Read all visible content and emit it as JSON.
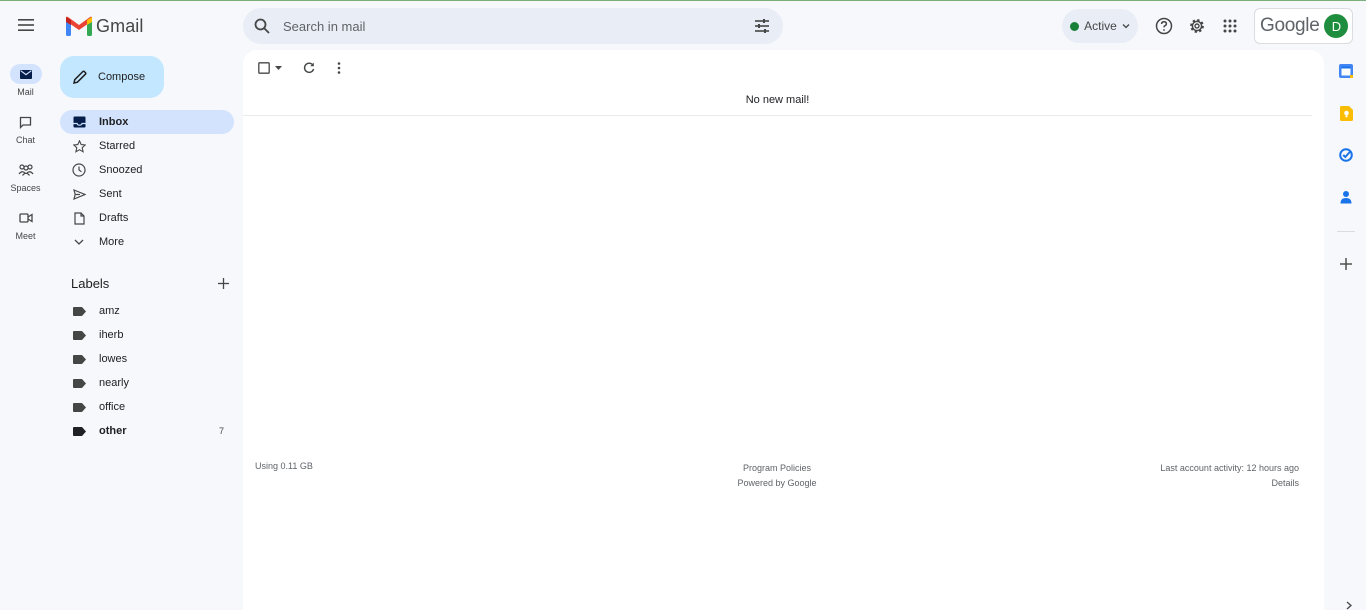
{
  "header": {
    "app_name": "Gmail",
    "search_placeholder": "Search in mail",
    "status_label": "Active",
    "account_brand": "Google",
    "avatar_initial": "D"
  },
  "rail": {
    "items": [
      {
        "label": "Mail",
        "icon": "mail-icon",
        "active": true
      },
      {
        "label": "Chat",
        "icon": "chat-icon",
        "active": false
      },
      {
        "label": "Spaces",
        "icon": "spaces-icon",
        "active": false
      },
      {
        "label": "Meet",
        "icon": "meet-icon",
        "active": false
      }
    ]
  },
  "sidebar": {
    "compose_label": "Compose",
    "items": [
      {
        "label": "Inbox",
        "icon": "inbox-icon",
        "active": true
      },
      {
        "label": "Starred",
        "icon": "star-icon"
      },
      {
        "label": "Snoozed",
        "icon": "clock-icon"
      },
      {
        "label": "Sent",
        "icon": "send-icon"
      },
      {
        "label": "Drafts",
        "icon": "draft-icon"
      },
      {
        "label": "More",
        "icon": "chevron-down-icon"
      }
    ],
    "labels_title": "Labels",
    "labels": [
      {
        "name": "amz",
        "count": ""
      },
      {
        "name": "iherb",
        "count": ""
      },
      {
        "name": "lowes",
        "count": ""
      },
      {
        "name": "nearly",
        "count": ""
      },
      {
        "name": "office",
        "count": ""
      },
      {
        "name": "other",
        "count": "7"
      }
    ]
  },
  "main": {
    "empty_message": "No new mail!",
    "storage_text": "Using 0.11 GB",
    "program_policies": "Program Policies",
    "powered_by": "Powered by Google",
    "last_activity": "Last account activity: 12 hours ago",
    "details_link": "Details"
  },
  "colors": {
    "active_bg": "#d3e3fd",
    "compose_bg": "#c2e7ff",
    "status_green": "#188038",
    "avatar_bg": "#1e8e3e"
  }
}
